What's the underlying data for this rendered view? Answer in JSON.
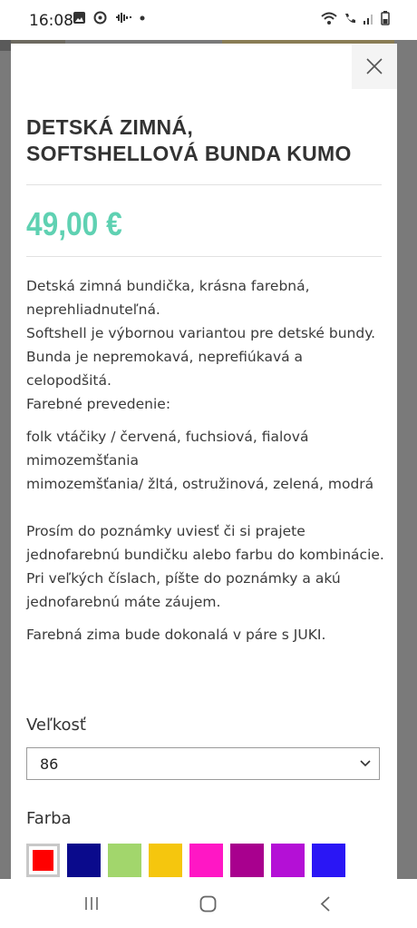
{
  "status": {
    "time": "16:08"
  },
  "product": {
    "title": "DETSKÁ ZIMNÁ, SOFTSHELLOVÁ BUNDA KUMO",
    "price": "49,00 €",
    "description": [
      "Detská zimná bundička, krásna farebná, neprehliadnuteľná.",
      "Softshell je výbornou variantou pre detské bundy.",
      "Bunda je nepremokavá, nepreﬁúkavá a celopodšitá.",
      "Farebné prevedenie:"
    ],
    "colors_text": [
      "folk vtáčiky / červená, fuchsiová, fialová",
      "mimozemšťania",
      "mimozemšťania/ žltá, ostružinová, zelená, modrá"
    ],
    "note": [
      "Prosím do poznámky uviesť či si prajete jednofarebnú bundičku alebo farbu do kombinácie.",
      "Pri veľkých číslach, píšte do poznámky a akú jednofarebnú máte záujem."
    ],
    "closing": "Farebná zima bude dokonalá v páre s JUKI."
  },
  "options": {
    "size_label": "Veľkosť",
    "size_value": "86",
    "color_label": "Farba",
    "swatches": [
      "#ff0000",
      "#0a0a8c",
      "#a2d66c",
      "#f5c60e",
      "#ff17c5",
      "#a8008e",
      "#b410d6",
      "#2a16f5"
    ]
  },
  "icons": {
    "close": "close-icon",
    "dropdown": "chevron-down-icon"
  }
}
